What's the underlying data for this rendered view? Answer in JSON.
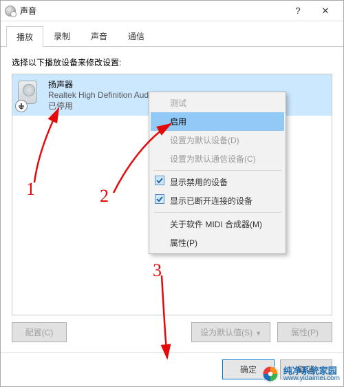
{
  "window": {
    "title": "声音"
  },
  "tabs": [
    {
      "label": "播放",
      "active": true
    },
    {
      "label": "录制",
      "active": false
    },
    {
      "label": "声音",
      "active": false
    },
    {
      "label": "通信",
      "active": false
    }
  ],
  "instruction": "选择以下播放设备来修改设置:",
  "device": {
    "name": "扬声器",
    "description": "Realtek High Definition Audio",
    "status": "已停用"
  },
  "context_menu": {
    "items": [
      {
        "label": "测试",
        "state": "disabled"
      },
      {
        "label": "启用",
        "state": "highlight"
      },
      {
        "label": "设置为默认设备(D)",
        "state": "disabled"
      },
      {
        "label": "设置为默认通信设备(C)",
        "state": "disabled"
      },
      {
        "type": "sep"
      },
      {
        "label": "显示禁用的设备",
        "state": "checked"
      },
      {
        "label": "显示已断开连接的设备",
        "state": "checked"
      },
      {
        "type": "sep"
      },
      {
        "label": "关于软件 MIDI 合成器(M)",
        "state": "normal"
      },
      {
        "label": "属性(P)",
        "state": "normal"
      }
    ]
  },
  "bottom_buttons": {
    "configure": "配置(C)",
    "set_default": "设为默认值(S)",
    "properties": "属性(P)"
  },
  "dialog_buttons": {
    "ok": "确定",
    "cancel": "取消"
  },
  "annotations": {
    "num1": "1",
    "num2": "2",
    "num3": "3"
  },
  "watermark": {
    "title": "纯净系统家园",
    "url": "www.yidaimei.com"
  }
}
